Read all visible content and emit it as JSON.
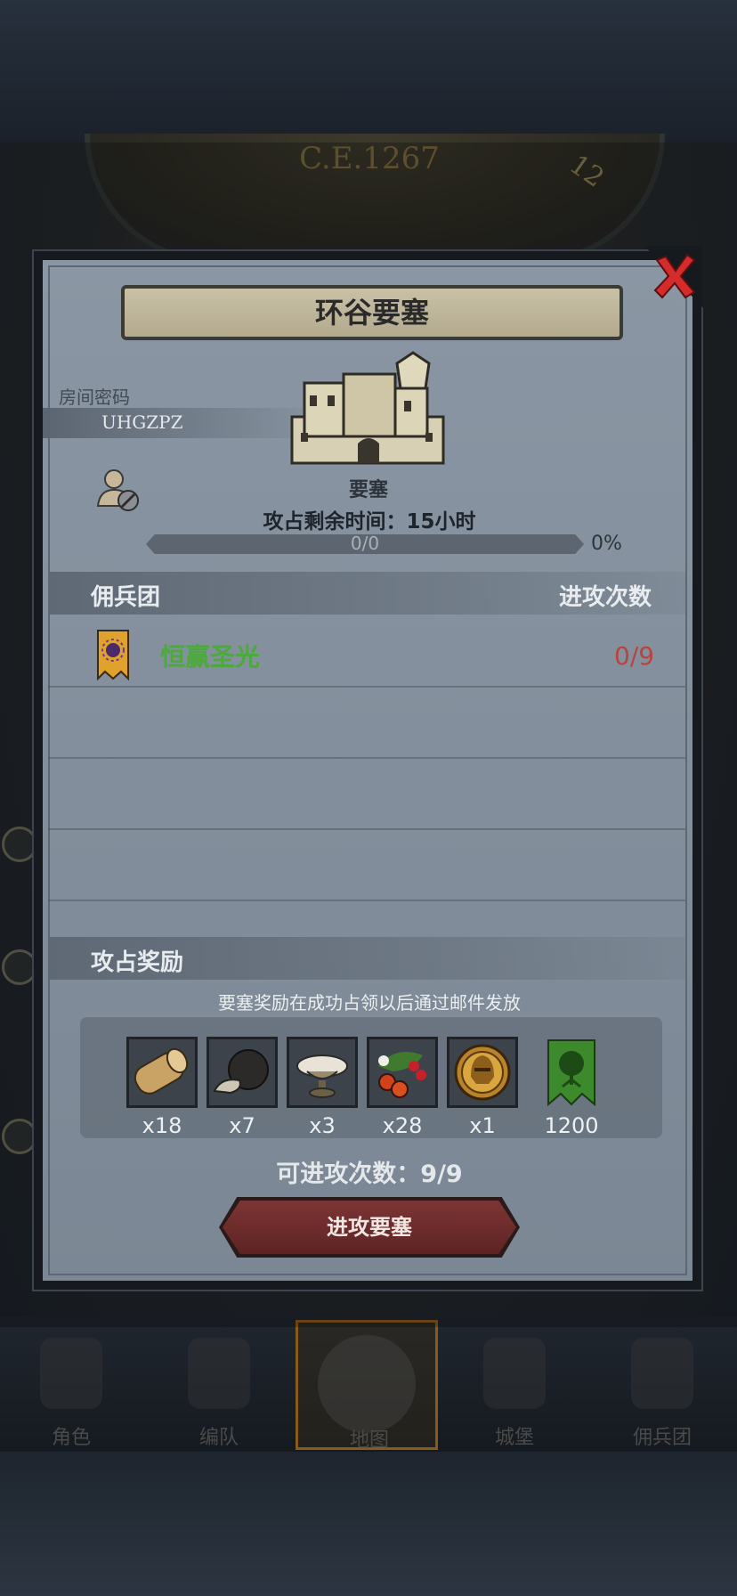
{
  "map": {
    "year": "C.E.1267",
    "dial_number": "12"
  },
  "modal": {
    "title": "环谷要塞",
    "room_code_label": "房间密码",
    "room_code": "UHGZPZ",
    "fort_type": "要塞",
    "time_remaining": "攻占剩余时间：15小时",
    "progress_text": "0/0",
    "progress_percent": "0%",
    "progress_value": 0,
    "mercenary_header": "佣兵团",
    "attack_count_header": "进攻次数",
    "guilds": [
      {
        "name": "恒赢圣光",
        "attacks": "0/9",
        "banner_icon": "sun-banner-icon"
      }
    ],
    "rewards_header": "攻占奖励",
    "rewards_note": "要塞奖励在成功占领以后通过邮件发放",
    "rewards": [
      {
        "icon": "wood-log-icon",
        "count": "x18"
      },
      {
        "icon": "truffle-icon",
        "count": "x7"
      },
      {
        "icon": "dish-icon",
        "count": "x3"
      },
      {
        "icon": "berries-icon",
        "count": "x28"
      },
      {
        "icon": "knight-helmet-coin-icon",
        "count": "x1"
      },
      {
        "icon": "tree-banner-icon",
        "count": "1200"
      }
    ],
    "remaining_attacks": "可进攻次数：9/9",
    "attack_button": "进攻要塞"
  },
  "nav": {
    "items": [
      {
        "label": "角色",
        "icon": "character-icon"
      },
      {
        "label": "编队",
        "icon": "formation-icon"
      },
      {
        "label": "地图",
        "icon": "map-icon",
        "active": true
      },
      {
        "label": "城堡",
        "icon": "castle-icon"
      },
      {
        "label": "佣兵团",
        "icon": "mercenary-icon"
      }
    ]
  },
  "colors": {
    "guild_name": "#4caa3c",
    "attack_count": "#b8443e",
    "close_x": "#d52b2b",
    "button": "#6e2c2c"
  }
}
